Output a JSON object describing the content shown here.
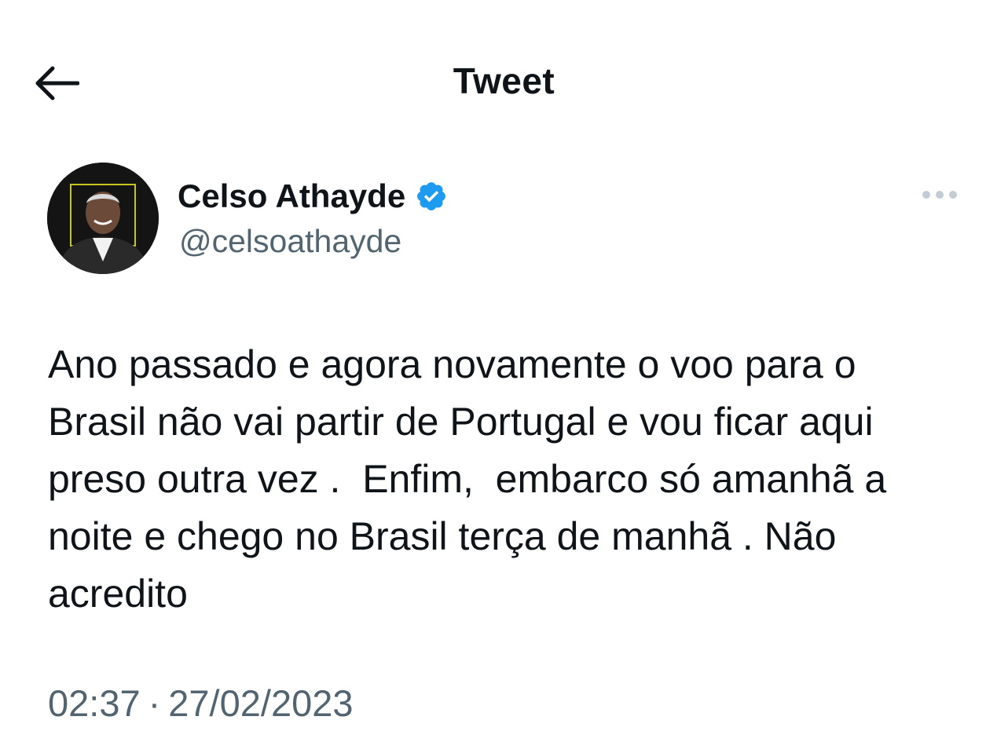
{
  "header": {
    "title": "Tweet",
    "back_icon": "arrow-left-icon"
  },
  "tweet": {
    "author": {
      "name": "Celso Athayde",
      "handle": "@celsoathayde",
      "verified": true,
      "verified_icon": "verified-badge-icon",
      "avatar": "avatar-photo"
    },
    "more_icon": "more-horizontal-icon",
    "text": "Ano passado e agora novamente o voo para o\nBrasil não vai partir de Portugal e vou ficar aqui\npreso outra vez .  Enfim,  embarco só amanhã a\nnoite e chego no Brasil terça de manhã . Não\nacredito",
    "time": "02:37",
    "separator": "·",
    "date": "27/02/2023"
  },
  "colors": {
    "text_primary": "#0f1419",
    "text_secondary": "#536471",
    "verified_blue": "#1d9bf0",
    "background": "#ffffff"
  }
}
